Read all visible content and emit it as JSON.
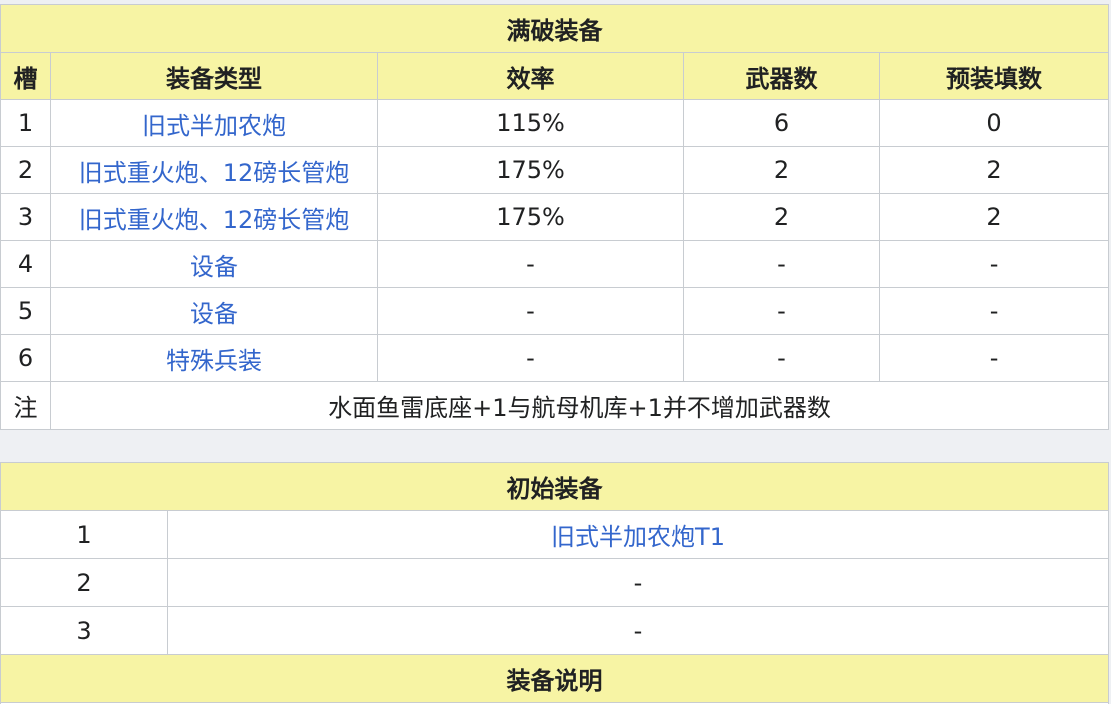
{
  "full_break": {
    "title": "满破装备",
    "headers": [
      "槽",
      "装备类型",
      "效率",
      "武器数",
      "预装填数"
    ],
    "rows": [
      {
        "slot": "1",
        "type": "旧式半加农炮",
        "eff": "115%",
        "weapons": "6",
        "preload": "0"
      },
      {
        "slot": "2",
        "type": "旧式重火炮、12磅长管炮",
        "eff": "175%",
        "weapons": "2",
        "preload": "2"
      },
      {
        "slot": "3",
        "type": "旧式重火炮、12磅长管炮",
        "eff": "175%",
        "weapons": "2",
        "preload": "2"
      },
      {
        "slot": "4",
        "type": "设备",
        "eff": "-",
        "weapons": "-",
        "preload": "-"
      },
      {
        "slot": "5",
        "type": "设备",
        "eff": "-",
        "weapons": "-",
        "preload": "-"
      },
      {
        "slot": "6",
        "type": "特殊兵装",
        "eff": "-",
        "weapons": "-",
        "preload": "-"
      }
    ],
    "note_label": "注",
    "note_text": "水面鱼雷底座+1与航母机库+1并不增加武器数"
  },
  "initial": {
    "title": "初始装备",
    "rows": [
      {
        "slot": "1",
        "item": "旧式半加农炮T1"
      },
      {
        "slot": "2",
        "item": "-"
      },
      {
        "slot": "3",
        "item": "-"
      }
    ],
    "desc_title": "装备说明"
  },
  "colors": {
    "header_bg": "#f7f4a4",
    "link": "#3366cc",
    "border": "#c8ccd1"
  }
}
